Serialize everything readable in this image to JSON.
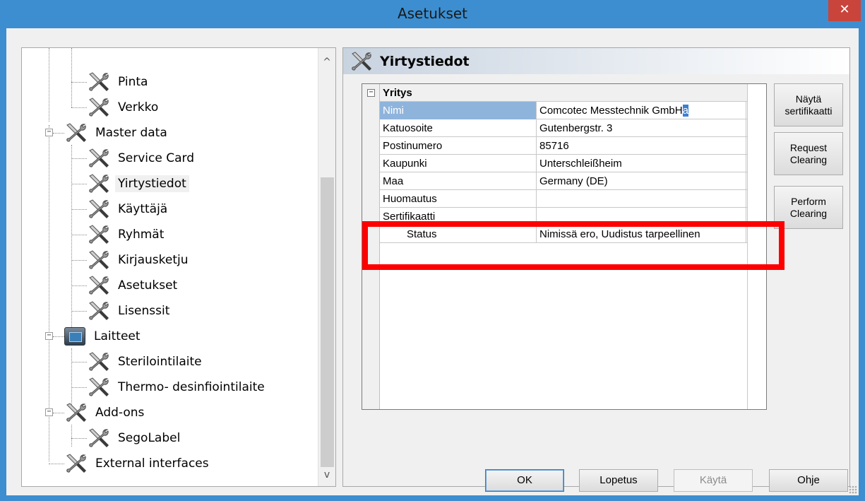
{
  "window": {
    "title": "Asetukset",
    "close_glyph": "✕"
  },
  "tree": {
    "items": [
      {
        "label": "Pinta"
      },
      {
        "label": "Verkko"
      },
      {
        "label": "Master data"
      },
      {
        "label": "Service Card"
      },
      {
        "label": "Yirtystiedot"
      },
      {
        "label": "Käyttäjä"
      },
      {
        "label": "Ryhmät"
      },
      {
        "label": "Kirjausketju"
      },
      {
        "label": "Asetukset"
      },
      {
        "label": "Lisenssit"
      },
      {
        "label": "Laitteet"
      },
      {
        "label": "Sterilointilaite"
      },
      {
        "label": "Thermo- desinfiointilaite"
      },
      {
        "label": "Add-ons"
      },
      {
        "label": "SegoLabel"
      },
      {
        "label": "External interfaces"
      }
    ],
    "selected": "Yirtystiedot",
    "scroll_up_glyph": "^",
    "scroll_down_glyph": "v",
    "expander_minus": "−"
  },
  "panel": {
    "title": "Yirtystiedot",
    "category": "Yritys",
    "properties": [
      {
        "key": "Nimi",
        "value": "Comcotec Messtechnik GmbH",
        "value_highlight": "a"
      },
      {
        "key": "Katuosoite",
        "value": "Gutenbergstr. 3"
      },
      {
        "key": "Postinumero",
        "value": "85716"
      },
      {
        "key": "Kaupunki",
        "value": "Unterschleißheim"
      },
      {
        "key": "Maa",
        "value": "Germany (DE)"
      },
      {
        "key": "Huomautus",
        "value": ""
      }
    ],
    "subcategory": "Sertifikaatti",
    "sub_properties": [
      {
        "key": "Status",
        "value": "Nimissä ero, Uudistus tarpeellinen"
      }
    ]
  },
  "side_buttons": {
    "show_certificate": [
      "Näytä",
      "sertifikaatti"
    ],
    "request_clearing": [
      "Request",
      "Clearing"
    ],
    "perform_clearing": [
      "Perform",
      "Clearing"
    ]
  },
  "bottom_buttons": {
    "ok": "OK",
    "cancel": "Lopetus",
    "apply": "Käytä",
    "help": "Ohje"
  },
  "colors": {
    "title_bar": "#3c8ed0",
    "close_button": "#c9443a",
    "highlight_box": "#ff0000",
    "selected_key_bg": "#8fb4dc"
  }
}
